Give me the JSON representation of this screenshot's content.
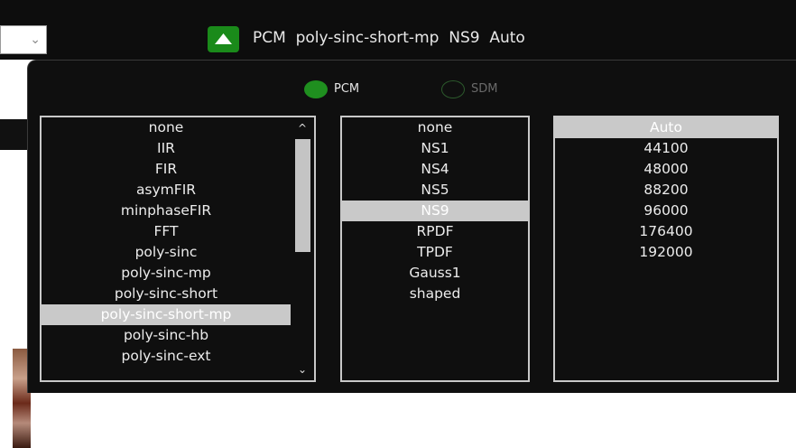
{
  "header": {
    "status_text": "PCM  poly-sinc-short-mp  NS9  Auto",
    "collapse_icon": "chevron-up-icon",
    "combo_icon": "chevron-down-icon"
  },
  "mode": {
    "pcm_label": "PCM",
    "sdm_label": "SDM",
    "selected": "PCM"
  },
  "filters": {
    "items": [
      "none",
      "IIR",
      "FIR",
      "asymFIR",
      "minphaseFIR",
      "FFT",
      "poly-sinc",
      "poly-sinc-mp",
      "poly-sinc-short",
      "poly-sinc-short-mp",
      "poly-sinc-hb",
      "poly-sinc-ext"
    ],
    "selected": "poly-sinc-short-mp",
    "scroll_up_icon": "chevron-up-icon",
    "scroll_down_icon": "chevron-down-icon"
  },
  "noise_shaping": {
    "items": [
      "none",
      "NS1",
      "NS4",
      "NS5",
      "NS9",
      "RPDF",
      "TPDF",
      "Gauss1",
      "shaped"
    ],
    "selected": "NS9"
  },
  "rates": {
    "items": [
      "Auto",
      "44100",
      "48000",
      "88200",
      "96000",
      "176400",
      "192000"
    ],
    "selected": "Auto"
  },
  "colors": {
    "accent_green": "#1f8f1f",
    "selection": "#c9c9c9",
    "panel_bg": "#0f0f0f"
  }
}
